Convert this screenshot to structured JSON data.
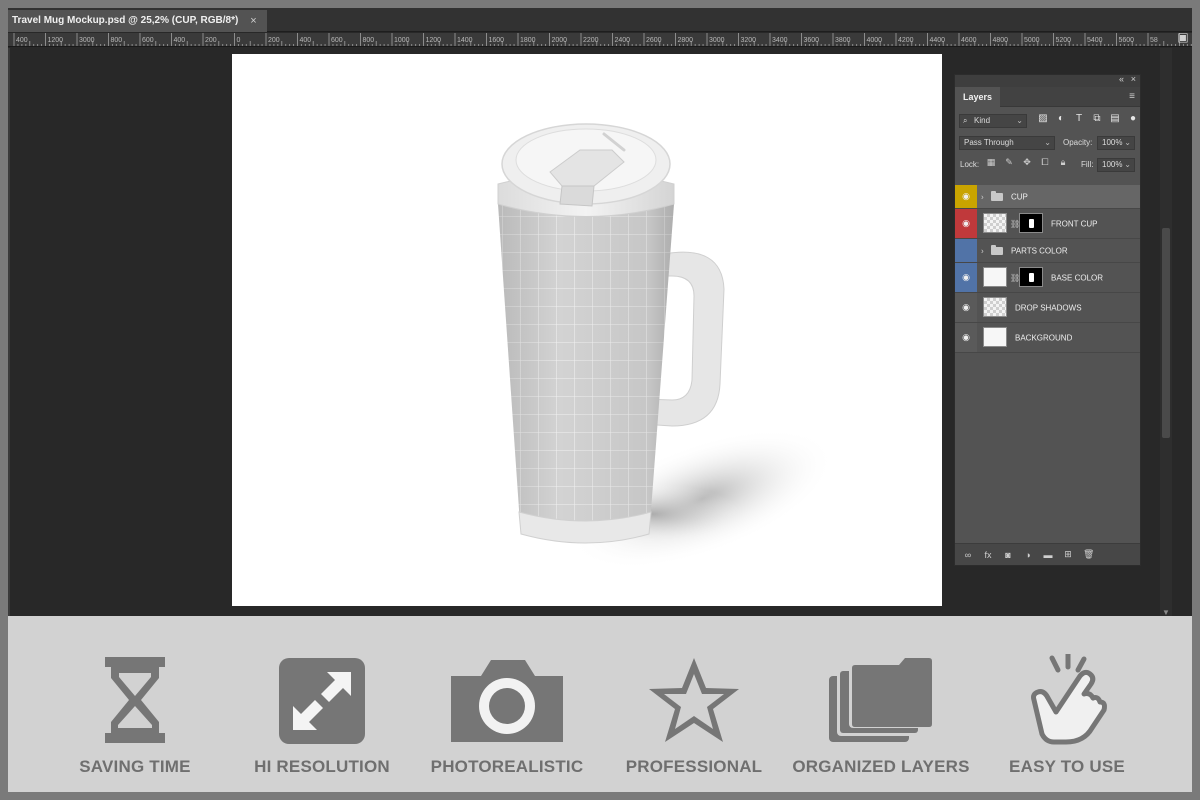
{
  "document": {
    "tab_title": "Travel Mug Mockup.psd @ 25,2% (CUP, RGB/8*)",
    "close_glyph": "×"
  },
  "ruler": {
    "labels": [
      "400",
      "1200",
      "3000",
      "800",
      "600",
      "400",
      "200",
      "0",
      "200",
      "400",
      "600",
      "800",
      "1000",
      "1200",
      "1400",
      "1600",
      "1800",
      "2000",
      "2200",
      "2400",
      "2600",
      "2800",
      "3000",
      "3200",
      "3400",
      "3600",
      "3800",
      "4000",
      "4200",
      "4400",
      "4600",
      "4800",
      "5000",
      "5200",
      "5400",
      "5600",
      "58"
    ]
  },
  "layers_panel": {
    "collapse_glyph": "«",
    "close_glyph": "×",
    "tab_label": "Layers",
    "menu_glyph": "≡",
    "filter": {
      "kind_label": "Kind",
      "search_glyph": "⌕"
    },
    "blend_mode": "Pass Through",
    "opacity_label": "Opacity:",
    "opacity_value": "100%",
    "lock_label": "Lock:",
    "fill_label": "Fill:",
    "fill_value": "100%",
    "layers": [
      {
        "name": "CUP",
        "type": "group",
        "eye_color": "#c9a400",
        "visible": true,
        "selected": true
      },
      {
        "name": "FRONT CUP",
        "type": "smart",
        "eye_color": "#c0393b",
        "visible": true,
        "selected": false
      },
      {
        "name": "PARTS COLOR",
        "type": "group",
        "eye_color": "#5173a7",
        "visible": false,
        "selected": false
      },
      {
        "name": "BASE COLOR",
        "type": "fill",
        "eye_color": "#5173a7",
        "visible": true,
        "selected": false
      },
      {
        "name": "DROP SHADOWS",
        "type": "pixel",
        "eye_color": "#535353",
        "visible": true,
        "selected": false
      },
      {
        "name": "BACKGROUND",
        "type": "white",
        "eye_color": "#535353",
        "visible": true,
        "selected": false
      }
    ],
    "bottom_icons": [
      "link-icon",
      "fx-icon",
      "mask-icon",
      "adjustment-icon",
      "folder-icon",
      "new-layer-icon",
      "trash-icon"
    ]
  },
  "features": [
    {
      "label": "SAVING TIME",
      "icon": "hourglass-icon"
    },
    {
      "label": "HI RESOLUTION",
      "icon": "expand-arrows-icon"
    },
    {
      "label": "PHOTOREALISTIC",
      "icon": "camera-icon"
    },
    {
      "label": "PROFESSIONAL",
      "icon": "star-icon"
    },
    {
      "label": "ORGANIZED LAYERS",
      "icon": "stacked-layers-icon"
    },
    {
      "label": "EASY TO USE",
      "icon": "tap-hand-icon"
    }
  ],
  "colors": {
    "frame_border": "#7a7a7a",
    "workspace": "#282828",
    "panel": "#535353",
    "feature_strip": "#d2d2d2",
    "feature_icon": "#767676"
  }
}
